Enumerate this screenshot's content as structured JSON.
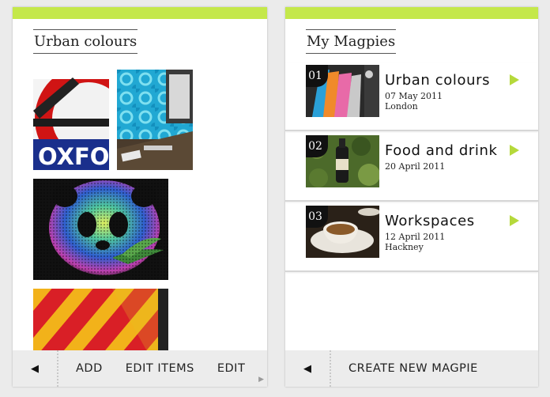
{
  "left_screen": {
    "title": "Urban colours",
    "thumbnails": [
      {
        "icon": "oxford-sign-photo"
      },
      {
        "icon": "blue-wallpaper-photo"
      },
      {
        "icon": "panda-halftone-photo"
      },
      {
        "icon": "red-yellow-chevron-photo"
      }
    ],
    "toolbar": {
      "back_glyph": "◀",
      "items": [
        "ADD",
        "EDIT ITEMS",
        "EDIT"
      ],
      "scroll_glyph": "▶"
    },
    "photo_text": "OXFO"
  },
  "right_screen": {
    "title": "My Magpies",
    "items": [
      {
        "number": "01",
        "title": "Urban colours",
        "date": "07 May 2011",
        "location": "London"
      },
      {
        "number": "02",
        "title": "Food and drink",
        "date": "20 April 2011",
        "location": ""
      },
      {
        "number": "03",
        "title": "Workspaces",
        "date": "12 April 2011",
        "location": "Hackney"
      }
    ],
    "toolbar": {
      "back_glyph": "◀",
      "create_label": "CREATE NEW MAGPIE"
    }
  },
  "colors": {
    "accent": "#c4e84a",
    "arrow": "#b5d93b",
    "toolbar_bg": "#ececec"
  }
}
